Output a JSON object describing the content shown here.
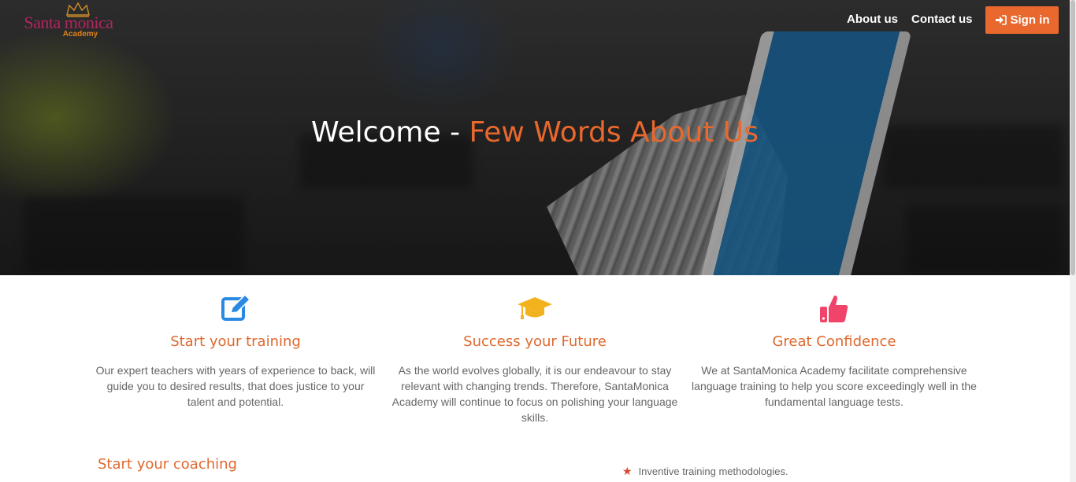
{
  "brand": {
    "name": "Santa monica",
    "sub": "Academy"
  },
  "nav": {
    "about_label": "About us",
    "contact_label": "Contact us",
    "signin_label": "Sign in"
  },
  "hero": {
    "title_start": "Welcome - ",
    "title_accent": "Few Words About Us"
  },
  "features": [
    {
      "icon": "edit-icon",
      "title": "Start your training",
      "text": "Our expert teachers with years of experience to back, will guide you to desired results, that does justice to your talent and potential."
    },
    {
      "icon": "graduation-cap-icon",
      "title": "Success your Future",
      "text": "As the world evolves globally, it is our endeavour to stay relevant with changing trends. Therefore, SantaMonica Academy will continue to focus on polishing your language skills."
    },
    {
      "icon": "thumbs-up-icon",
      "title": "Great Confidence",
      "text": "We at SantaMonica Academy facilitate comprehensive language training to help you score exceedingly well in the fundamental language tests."
    }
  ],
  "coaching": {
    "title": "Start your coaching",
    "bullets": [
      "Inventive training methodologies."
    ]
  },
  "colors": {
    "accent": "#e8682d",
    "brand": "#b0265d",
    "icon_blue": "#2a8ae2",
    "icon_yellow": "#f2b21e",
    "icon_pink": "#f0446a"
  }
}
